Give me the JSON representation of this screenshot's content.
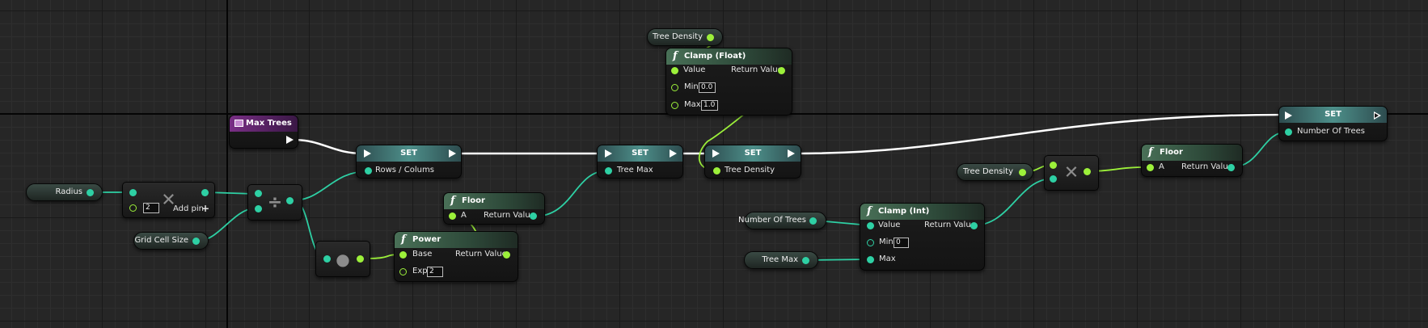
{
  "nodes": {
    "max_trees": {
      "title": "Max Trees"
    },
    "radius": {
      "label": "Radius"
    },
    "grid_cell_size": {
      "label": "Grid Cell Size"
    },
    "multiply": {
      "b_default": "2",
      "add_pin": "Add pin",
      "add_pin_icon": "plus-icon"
    },
    "set_rows": {
      "title": "SET",
      "input": "Rows / Colums"
    },
    "floor_1": {
      "title": "Floor",
      "in": "A",
      "out": "Return Value"
    },
    "power": {
      "title": "Power",
      "base": "Base",
      "exp": "Exp",
      "exp_default": "2",
      "out": "Return Value"
    },
    "set_tree_max": {
      "title": "SET",
      "input": "Tree Max"
    },
    "tree_density_top": {
      "label": "Tree Density"
    },
    "clamp_float": {
      "title": "Clamp (Float)",
      "value": "Value",
      "out": "Return Value",
      "min": "Min",
      "min_default": "0.0",
      "max": "Max",
      "max_default": "1.0"
    },
    "set_tree_density": {
      "title": "SET",
      "input": "Tree Density"
    },
    "number_of_trees_get": {
      "label": "Number Of Trees"
    },
    "tree_max_get": {
      "label": "Tree Max"
    },
    "clamp_int": {
      "title": "Clamp (Int)",
      "value": "Value",
      "out": "Return Value",
      "min": "Min",
      "min_default": "0",
      "max": "Max"
    },
    "tree_density_mid": {
      "label": "Tree Density"
    },
    "floor_2": {
      "title": "Floor",
      "in": "A",
      "out": "Return Value"
    },
    "set_number_of_trees": {
      "title": "SET",
      "input": "Number Of Trees"
    }
  },
  "colors": {
    "background": "#262626",
    "exec_wire": "#ffffff",
    "float_pin": "#9cf03a",
    "int_pin": "#2ed0a4",
    "variable_header": "#7a2f86",
    "function_header": "#497057",
    "set_header": "#4d8f8a"
  }
}
